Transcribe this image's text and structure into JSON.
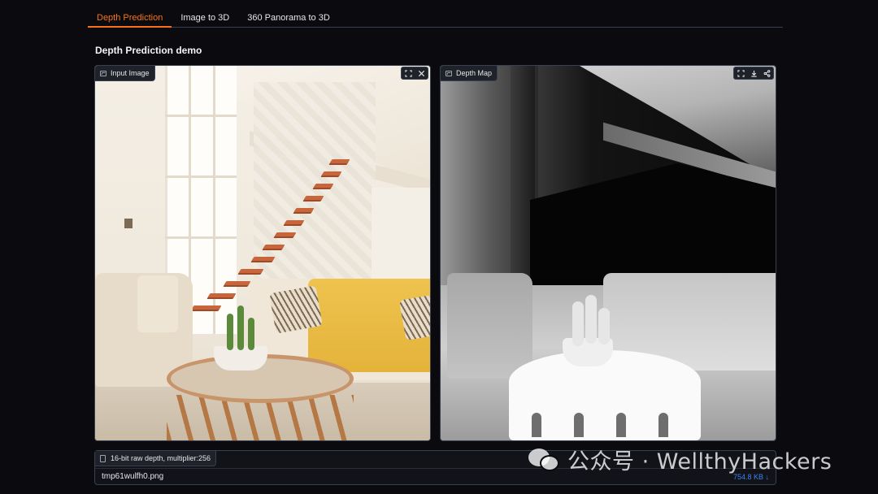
{
  "tabs": [
    {
      "label": "Depth Prediction",
      "active": true
    },
    {
      "label": "Image to 3D",
      "active": false
    },
    {
      "label": "360 Panorama to 3D",
      "active": false
    }
  ],
  "section_title": "Depth Prediction demo",
  "input_panel": {
    "label": "Input Image",
    "icons": [
      "fullscreen-icon",
      "close-icon"
    ]
  },
  "depth_panel": {
    "label": "Depth Map",
    "icons": [
      "fullscreen-icon",
      "download-icon",
      "share-icon"
    ]
  },
  "file_output": {
    "label": "16-bit raw depth, multiplier:256",
    "file_name": "tmp61wulfh0.png",
    "file_size": "754.8 KB ↓"
  },
  "watermark": {
    "text": "公众号 · WellthyHackers"
  },
  "colors": {
    "background": "#0b0b0f",
    "accent": "#f97316",
    "link": "#3b82f6",
    "border": "#374151"
  }
}
